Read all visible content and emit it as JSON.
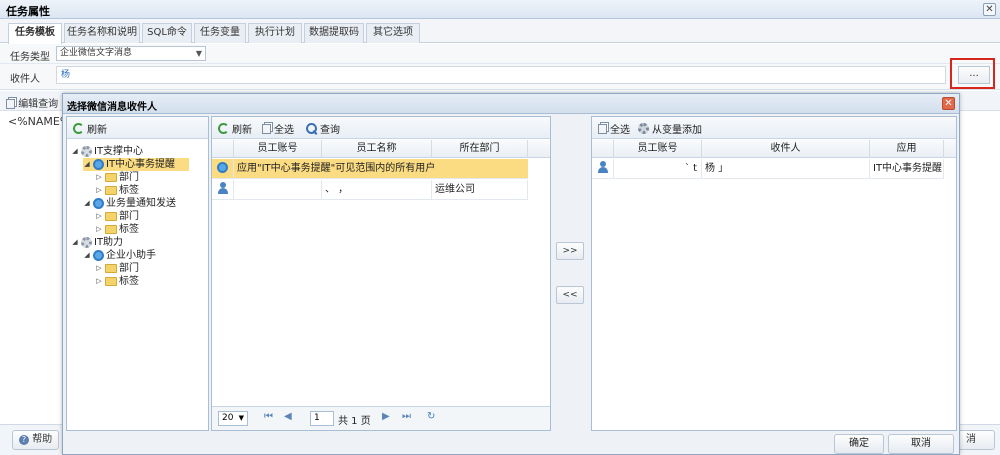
{
  "window": {
    "title": "任务属性",
    "close": "✕"
  },
  "tabs": [
    {
      "label": "任务模板"
    },
    {
      "label": "任务名称和说明"
    },
    {
      "label": "SQL命令"
    },
    {
      "label": "任务变量"
    },
    {
      "label": "执行计划"
    },
    {
      "label": "数据提取码"
    },
    {
      "label": "其它选项"
    }
  ],
  "form": {
    "type_label": "任务类型",
    "type_value": "企业微信文字消息",
    "recipient_label": "收件人",
    "recipient_value": "杨",
    "dots_label": "..."
  },
  "background": {
    "editor_button": "编辑查询",
    "editor_text": "<%NAME%",
    "help_button": "帮助",
    "cancel_partial": "消"
  },
  "dialog": {
    "title": "选择微信消息收件人",
    "close": "✕",
    "tree": {
      "refresh": "刷新",
      "nodes": [
        {
          "label": "IT支撑中心",
          "icon": "gear-icon",
          "level": 0,
          "expanded": true
        },
        {
          "label": "IT中心事务提醒",
          "icon": "circle-icon",
          "level": 1,
          "expanded": true,
          "selected": true
        },
        {
          "label": "部门",
          "icon": "folder-icon",
          "level": 2
        },
        {
          "label": "标签",
          "icon": "folder-icon",
          "level": 2
        },
        {
          "label": "业务量通知发送",
          "icon": "circle-icon",
          "level": 1,
          "expanded": true
        },
        {
          "label": "部门",
          "icon": "folder-icon",
          "level": 2
        },
        {
          "label": "标签",
          "icon": "folder-icon",
          "level": 2
        },
        {
          "label": "IT助力",
          "icon": "gear-icon",
          "level": 0,
          "expanded": true
        },
        {
          "label": "企业小助手",
          "icon": "circle-icon",
          "level": 1,
          "expanded": true
        },
        {
          "label": "部门",
          "icon": "folder-icon",
          "level": 2
        },
        {
          "label": "标签",
          "icon": "folder-icon",
          "level": 2
        }
      ]
    },
    "middle": {
      "toolbar": {
        "refresh": "刷新",
        "select_all": "全选",
        "query": "查询"
      },
      "columns": [
        "员工账号",
        "员工名称",
        "所在部门"
      ],
      "rows": [
        {
          "icon": "circle-icon",
          "merged": "应用\"IT中心事务提醒\"可见范围内的所有用户",
          "selected": true
        },
        {
          "icon": "user-icon",
          "account": "",
          "name": "、   ，",
          "dept": "运维公司"
        }
      ],
      "pager": {
        "page_size": "20",
        "page_input": "1",
        "total": "共 1 页"
      }
    },
    "move_right": ">>",
    "move_left": "<<",
    "right": {
      "toolbar": {
        "select_all": "全选",
        "add_from_var": "从变量添加"
      },
      "columns": [
        "员工账号",
        "收件人",
        "应用"
      ],
      "rows": [
        {
          "icon": "user-icon",
          "account": "`     t",
          "recipient": "杨 」",
          "app": "IT中心事务提醒"
        }
      ]
    },
    "ok": "确定",
    "cancel": "取消"
  },
  "colors": {
    "accent": "#2f7dc6",
    "selected": "#fbdc82",
    "highlight_border": "#d9261c"
  }
}
